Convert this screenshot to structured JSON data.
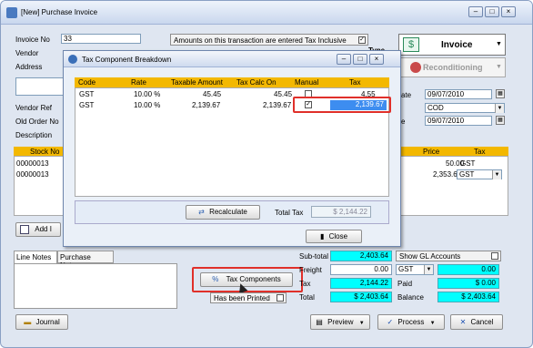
{
  "window": {
    "title": "[New] Purchase Invoice"
  },
  "header": {
    "invoice_no_label": "Invoice No",
    "invoice_no_value": "33",
    "vendor_label": "Vendor",
    "address_label": "Address",
    "vendor_ref_label": "Vendor Ref",
    "old_order_label": "Old Order No",
    "description_label": "Description",
    "tax_inclusive_label": "Amounts on this transaction are entered Tax Inclusive",
    "tax_inclusive_checked": "✓",
    "type_label": "Type",
    "invoice_button": "Invoice",
    "reconditioning_button": "Reconditioning",
    "date_label": "ate",
    "date_value": "09/07/2010",
    "terms_label": "",
    "terms_value": "COD",
    "due_label": "e",
    "due_value": "09/07/2010"
  },
  "lines": {
    "headers": [
      "Stock No",
      "Price",
      "Tax"
    ],
    "rows": [
      {
        "stock": "00000013",
        "price": "50.00",
        "tax": "GST"
      },
      {
        "stock": "00000013",
        "price": "2,353.64",
        "tax": "GST"
      }
    ],
    "add_label": "Add I"
  },
  "notes": {
    "tab_line": "Line Notes",
    "tab_purchase": "Purchase Notes"
  },
  "totals": {
    "subtotal_label": "Sub-total",
    "subtotal_value": "2,403.64",
    "freight_label": "Freight",
    "freight_value": "0.00",
    "tax_label": "Tax",
    "tax_value": "2,144.22",
    "total_label": "Total",
    "total_value": "$ 2,403.64",
    "show_gl_label": "Show GL Accounts",
    "gst_label": "GST",
    "gst_value": "0.00",
    "right_tax_value": "0.00",
    "paid_label": "Paid",
    "paid_value": "$ 0.00",
    "balance_label": "Balance",
    "balance_value": "$ 2,403.64"
  },
  "buttons": {
    "tax_components": "Tax Components",
    "has_been_printed": "Has been Printed",
    "journal": "Journal",
    "preview": "Preview",
    "process": "Process",
    "cancel": "Cancel"
  },
  "dialog": {
    "title": "Tax Component Breakdown",
    "headers": [
      "Code",
      "Rate",
      "Taxable Amount",
      "Tax Calc On",
      "Manual",
      "Tax"
    ],
    "rows": [
      {
        "code": "GST",
        "rate": "10.00 %",
        "taxable": "45.45",
        "calc": "45.45",
        "manual": "",
        "tax": "4.55"
      },
      {
        "code": "GST",
        "rate": "10.00 %",
        "taxable": "2,139.67",
        "calc": "2,139.67",
        "manual": "✓",
        "tax": "2,139.67"
      }
    ],
    "recalculate_label": "Recalculate",
    "total_tax_label": "Total Tax",
    "total_tax_value": "$ 2,144.22",
    "close_label": "Close"
  },
  "colors": {
    "grid_header": "#f3b800",
    "highlight": "#00ffff",
    "callout": "#e0302a"
  }
}
